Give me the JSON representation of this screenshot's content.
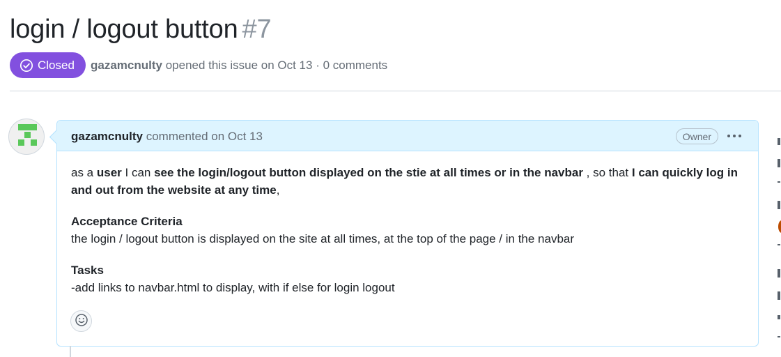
{
  "issue": {
    "title": "login / logout button",
    "number": "#7",
    "state": "Closed",
    "author": "gazamcnulty",
    "meta_text": "opened this issue on Oct 13 · 0 comments"
  },
  "comment": {
    "author": "gazamcnulty",
    "meta_text": "commented on Oct 13",
    "role_badge": "Owner",
    "story": {
      "p1": "as a ",
      "role": "user",
      "p2": " I can ",
      "goal": "see the login/logout button displayed on the stie at all times or in the navbar",
      "p3": " , so that ",
      "benefit": "I can quickly log in and out from the website at any time",
      "p4": ","
    },
    "acceptance_heading": "Acceptance Criteria",
    "acceptance_text": "the login / logout button is displayed on the site at all times, at the top of the page / in the navbar",
    "tasks_heading": "Tasks",
    "tasks_text": "-add links to navbar.html to display, with if else for login logout"
  },
  "icons": {
    "state": "check-circle-icon",
    "menu": "kebab-horizontal-icon",
    "reaction": "smiley-icon",
    "avatar": "identicon-avatar"
  },
  "colors": {
    "closed_badge": "#8250df",
    "comment_header_bg": "#ddf4ff",
    "comment_border": "#b6e3ff",
    "identicon": "#5ac85a"
  }
}
